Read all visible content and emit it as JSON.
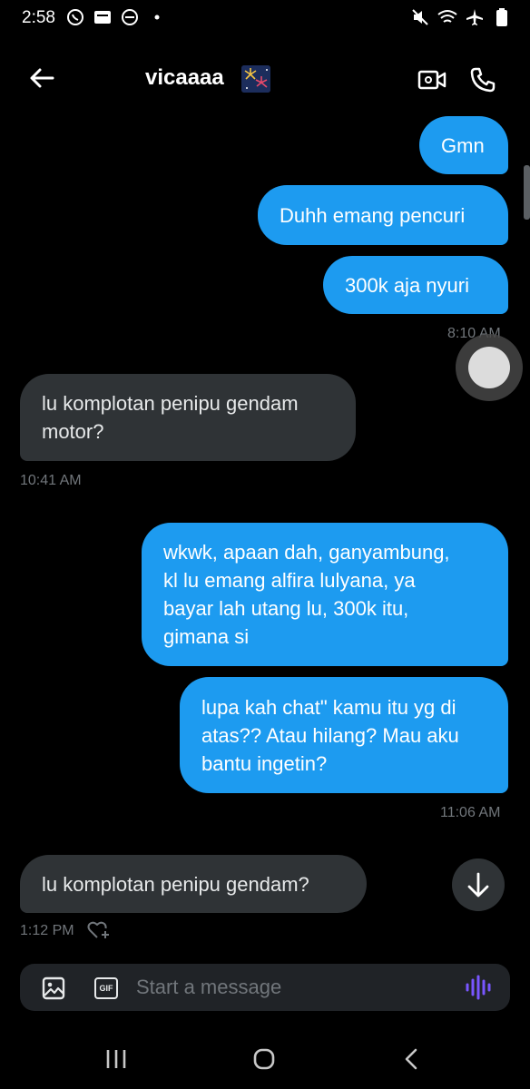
{
  "status_bar": {
    "time": "2:58"
  },
  "header": {
    "contact_name": "vicaaaa"
  },
  "messages": [
    {
      "text": "Gmn"
    },
    {
      "text": "Duhh emang pencuri"
    },
    {
      "text": "300k aja nyuri"
    },
    {
      "text": "lu komplotan penipu gendam motor?",
      "lines": [
        "lu komplotan penipu gendam",
        "motor?"
      ]
    },
    {
      "text": "wkwk, apaan dah, ganyambung, kl lu emang alfira lulyana, ya bayar lah utang lu, 300k itu, gimana si",
      "lines": [
        "wkwk, apaan dah, ganyambung,",
        "kl lu emang alfira lulyana, ya",
        "bayar lah utang lu, 300k itu,",
        "gimana si"
      ]
    },
    {
      "text": "lupa kah chat\" kamu itu yg di atas?? Atau hilang? Mau aku bantu ingetin?",
      "lines": [
        "lupa kah chat\" kamu itu yg di",
        "atas?? Atau hilang? Mau aku",
        "bantu ingetin?"
      ]
    },
    {
      "text": "lu komplotan penipu gendam?"
    }
  ],
  "timestamps": {
    "t1": "8:10 AM",
    "t2": "10:41 AM",
    "t3": "11:06 AM",
    "t4": "1:12 PM"
  },
  "composer": {
    "placeholder": "Start a message",
    "gif_label": "GIF"
  },
  "colors": {
    "background": "#000000",
    "outgoing_bubble": "#1d9bf0",
    "incoming_bubble": "#2f3336",
    "muted_text": "#71767b",
    "voice_accent": "#7856ff"
  },
  "icons": [
    "arrow-left-icon",
    "video-icon",
    "phone-icon",
    "image-icon",
    "gif-icon",
    "voice-icon",
    "arrow-down-icon",
    "heart-plus-icon"
  ]
}
